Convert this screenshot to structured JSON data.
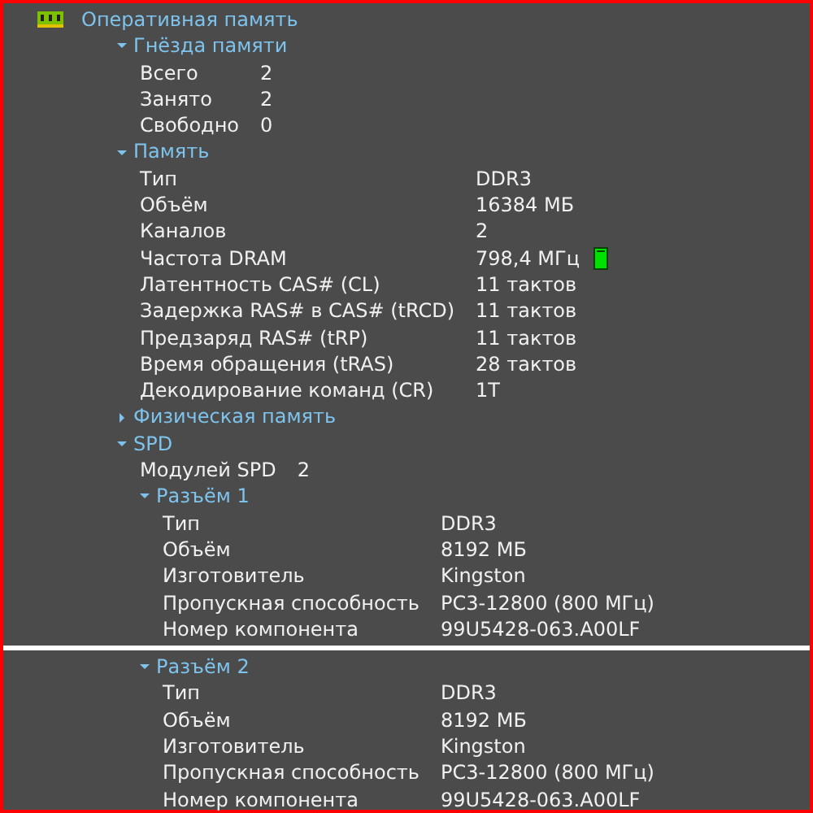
{
  "tree": {
    "title": "Оперативная память",
    "children": [
      {
        "kind": "group",
        "title": "Гнёзда памяти",
        "expanded": true,
        "children": [
          {
            "kind": "row",
            "label": "Всего",
            "value": "2"
          },
          {
            "kind": "row",
            "label": "Занято",
            "value": "2"
          },
          {
            "kind": "row",
            "label": "Свободно",
            "value": "0"
          }
        ]
      },
      {
        "kind": "group",
        "title": "Память",
        "expanded": true,
        "children": [
          {
            "kind": "row",
            "label": "Тип",
            "value": "DDR3"
          },
          {
            "kind": "row",
            "label": "Объём",
            "value": "16384 МБ"
          },
          {
            "kind": "row",
            "label": "Каналов",
            "value": "2"
          },
          {
            "kind": "row",
            "label": "Частота DRAM",
            "value": "798,4 МГц",
            "indicator": true
          },
          {
            "kind": "row",
            "label": "Латентность CAS# (CL)",
            "value": "11 тактов"
          },
          {
            "kind": "row",
            "label": "Задержка RAS# в CAS# (tRCD)",
            "value": "11 тактов"
          },
          {
            "kind": "row",
            "label": "Предзаряд RAS# (tRP)",
            "value": "11 тактов"
          },
          {
            "kind": "row",
            "label": "Время обращения (tRAS)",
            "value": "28 тактов"
          },
          {
            "kind": "row",
            "label": "Декодирование команд (CR)",
            "value": "1T"
          }
        ]
      },
      {
        "kind": "group",
        "title": "Физическая память",
        "expanded": false
      },
      {
        "kind": "group",
        "title": "SPD",
        "expanded": true,
        "children": [
          {
            "kind": "row",
            "label": "Модулей SPD",
            "value": "2"
          },
          {
            "kind": "group",
            "title": "Разъём 1",
            "expanded": true,
            "children": [
              {
                "kind": "row",
                "label": "Тип",
                "value": "DDR3"
              },
              {
                "kind": "row",
                "label": "Объём",
                "value": "8192 МБ"
              },
              {
                "kind": "row",
                "label": "Изготовитель",
                "value": "Kingston"
              },
              {
                "kind": "row",
                "label": "Пропускная способность",
                "value": "PC3-12800 (800 МГц)"
              },
              {
                "kind": "row",
                "label": "Номер компонента",
                "value": "99U5428-063.A00LF"
              }
            ]
          },
          {
            "kind": "group",
            "title": "Разъём 2",
            "expanded": true,
            "divider_before": true,
            "children": [
              {
                "kind": "row",
                "label": "Тип",
                "value": "DDR3"
              },
              {
                "kind": "row",
                "label": "Объём",
                "value": "8192 МБ"
              },
              {
                "kind": "row",
                "label": "Изготовитель",
                "value": "Kingston"
              },
              {
                "kind": "row",
                "label": "Пропускная способность",
                "value": "PC3-12800 (800 МГц)"
              },
              {
                "kind": "row",
                "label": "Номер компонента",
                "value": "99U5428-063.A00LF"
              }
            ]
          }
        ]
      }
    ]
  }
}
